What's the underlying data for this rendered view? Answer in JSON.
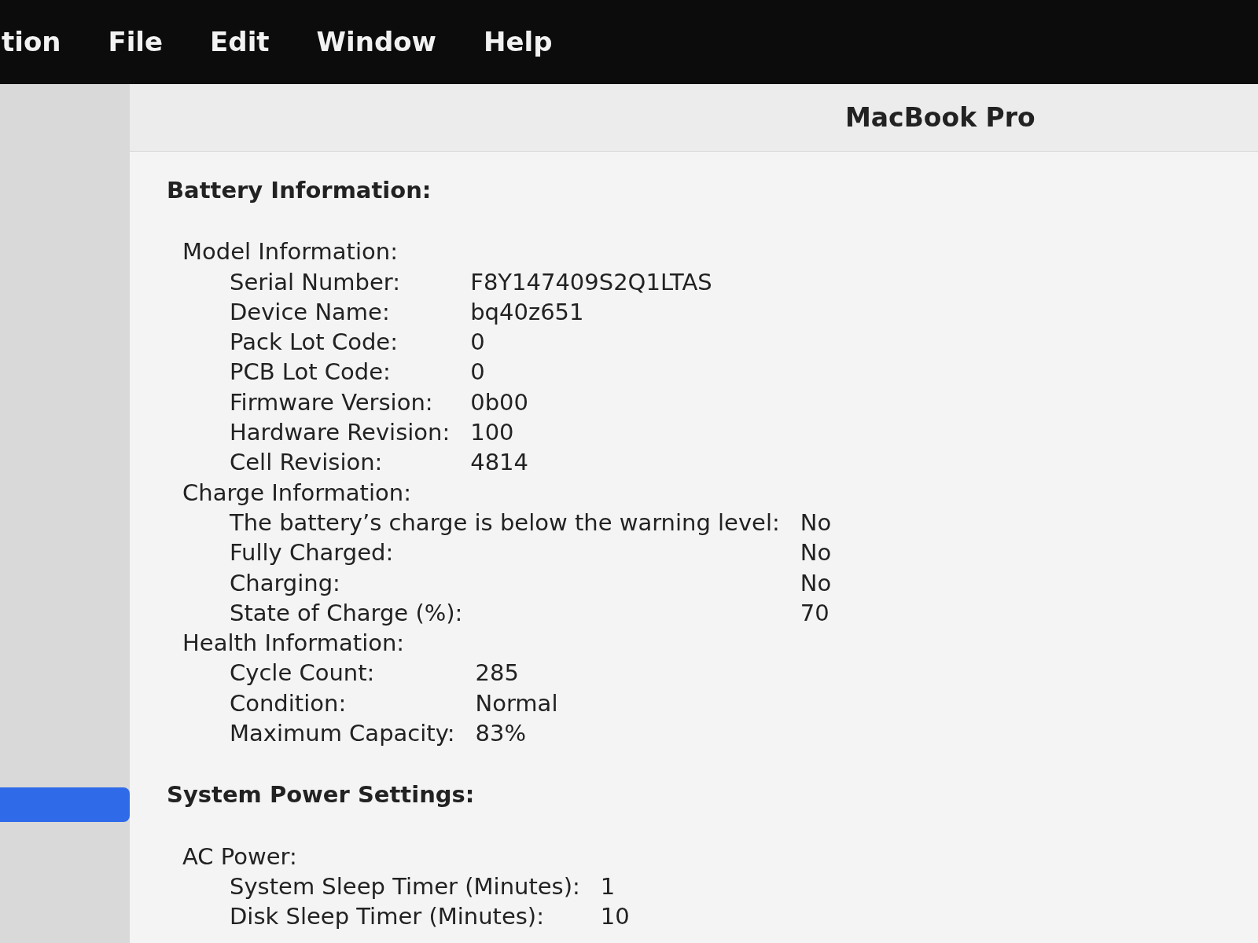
{
  "menu_bar": {
    "items": [
      "tion",
      "File",
      "Edit",
      "Window",
      "Help"
    ]
  },
  "sidebar": {
    "items": [
      {
        "selected": true
      }
    ]
  },
  "header": {
    "title": "MacBook Pro"
  },
  "sections": [
    {
      "title": "Battery Information:",
      "groups": [
        {
          "title": "Model Information:",
          "rows": [
            {
              "label": "Serial Number:",
              "value": "F8Y147409S2Q1LTAS"
            },
            {
              "label": "Device Name:",
              "value": "bq40z651"
            },
            {
              "label": "Pack Lot Code:",
              "value": "0"
            },
            {
              "label": "PCB Lot Code:",
              "value": "0"
            },
            {
              "label": "Firmware Version:",
              "value": "0b00"
            },
            {
              "label": "Hardware Revision:",
              "value": "100"
            },
            {
              "label": "Cell Revision:",
              "value": "4814"
            }
          ]
        },
        {
          "title": "Charge Information:",
          "rows": [
            {
              "label": "The battery’s charge is below the warning level:",
              "value": "No"
            },
            {
              "label": "Fully Charged:",
              "value": "No"
            },
            {
              "label": "Charging:",
              "value": "No"
            },
            {
              "label": "State of Charge (%):",
              "value": "70"
            }
          ]
        },
        {
          "title": "Health Information:",
          "rows": [
            {
              "label": "Cycle Count:",
              "value": "285"
            },
            {
              "label": "Condition:",
              "value": "Normal"
            },
            {
              "label": "Maximum Capacity:",
              "value": "83%"
            }
          ]
        }
      ]
    },
    {
      "title": "System Power Settings:",
      "groups": [
        {
          "title": "AC Power:",
          "rows": [
            {
              "label": "System Sleep Timer (Minutes):",
              "value": "1"
            },
            {
              "label": "Disk Sleep Timer (Minutes):",
              "value": "10"
            }
          ]
        }
      ]
    }
  ]
}
